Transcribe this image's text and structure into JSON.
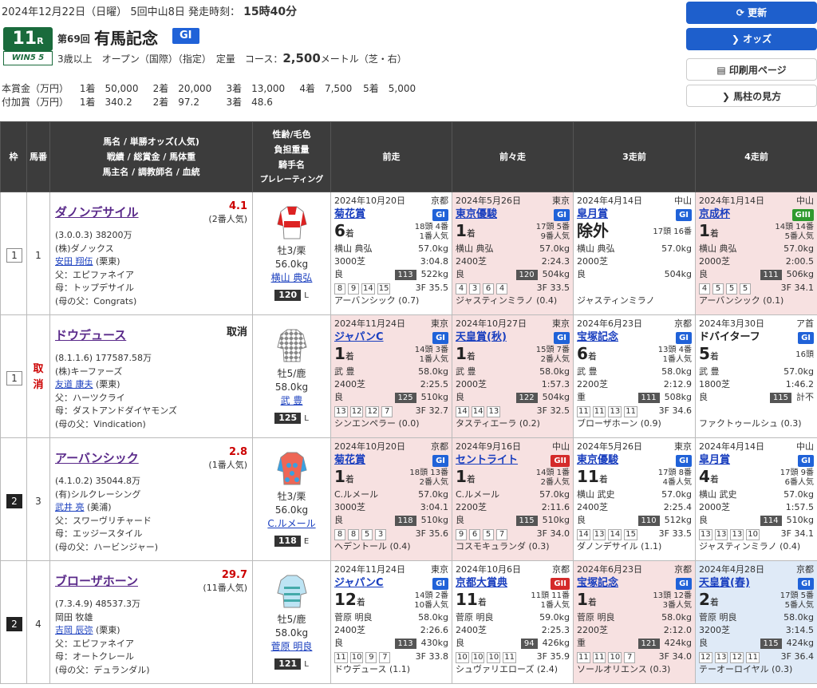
{
  "header": {
    "date": "2024年12月22日（日曜）",
    "meeting": "5回中山8日",
    "post_label": "発走時刻：",
    "post_time": "15時40分",
    "race_no": "11",
    "race_unit": "R",
    "win5_label": "WIN5 5",
    "race_count": "第69回",
    "race_name": "有馬記念",
    "grade": "GI",
    "conditions": "3歳以上　オープン（国際）（指定）　定量　コース：",
    "distance": "2,500",
    "course_suffix": "メートル（芝・右）",
    "prize_label": "本賞金（万円）",
    "prize_values": [
      "1着　50,000",
      "2着　20,000",
      "3着　13,000",
      "4着　7,500",
      "5着　5,000"
    ],
    "addprize_label": "付加賞（万円）",
    "addprize_values": [
      "1着　340.2",
      "2着　97.2",
      "3着　48.6"
    ]
  },
  "buttons": {
    "refresh": "⟳ 更新",
    "odds": "❯ オッズ",
    "print": "▤ 印刷用ページ",
    "howto": "❯ 馬柱の見方"
  },
  "columns": {
    "waku": "枠",
    "umaban": "馬番",
    "horse": [
      "馬名 / 単勝オッズ(人気)",
      "戦績 / 総賞金 / 馬体重",
      "馬主名 / 調教師名 / 血統"
    ],
    "jockey": [
      "性齢/毛色",
      "負担重量",
      "騎手名",
      "プレレーティング"
    ],
    "prev1": "前走",
    "prev2": "前々走",
    "prev3": "3走前",
    "prev4": "4走前"
  },
  "horses": [
    {
      "waku": "1",
      "umaban": "1",
      "scratch": "",
      "name": "ダノンデサイル",
      "odds": "4.1",
      "pop": "(2番人気)",
      "record": "(3.0.0.3)  38200万",
      "owner": "(株)ダノックス",
      "trainer": "安田 翔伍",
      "trainer_loc": "(栗東)",
      "sire": "父：エピファネイア",
      "dam": "母：トップデサイル",
      "damsire": "(母の父：Congrats)",
      "sex_age": "牡3/栗",
      "weight": "56.0kg",
      "jockey": "横山 典弘",
      "rating": "120",
      "rating_side": "L",
      "past": [
        {
          "date": "2024年10月20日",
          "venue": "京都",
          "race": "菊花賞",
          "grade": "GI",
          "pos": "6",
          "pos_suf": "着",
          "field": "18頭 4番",
          "pop": "1番人気",
          "jockey": "横山 典弘",
          "kg": "57.0kg",
          "course": "3000芝",
          "time": "3:04.8",
          "going": "良",
          "badge": "113",
          "bw": "522kg",
          "corners": [
            "8",
            "9",
            "14",
            "15"
          ],
          "f3": "3F 35.5",
          "winner": "アーバンシック (0.7)",
          "bg": "w"
        },
        {
          "date": "2024年5月26日",
          "venue": "東京",
          "race": "東京優駿",
          "grade": "GI",
          "pos": "1",
          "pos_suf": "着",
          "field": "17頭 5番",
          "pop": "9番人気",
          "jockey": "横山 典弘",
          "kg": "57.0kg",
          "course": "2400芝",
          "time": "2:24.3",
          "going": "良",
          "badge": "120",
          "bw": "504kg",
          "corners": [
            "4",
            "3",
            "6",
            "4"
          ],
          "f3": "3F 33.5",
          "winner": "ジャスティンミラノ (0.4)",
          "bg": "p"
        },
        {
          "date": "2024年4月14日",
          "venue": "中山",
          "race": "皐月賞",
          "grade": "GI",
          "pos": "除外",
          "pos_suf": "",
          "field": "17頭 16番",
          "pop": "",
          "jockey": "横山 典弘",
          "kg": "57.0kg",
          "course": "2000芝",
          "time": "",
          "going": "良",
          "badge": "",
          "bw": "504kg",
          "corners": [],
          "f3": "",
          "winner": "ジャスティンミラノ",
          "bg": "w"
        },
        {
          "date": "2024年1月14日",
          "venue": "中山",
          "race": "京成杯",
          "grade": "GIII",
          "pos": "1",
          "pos_suf": "着",
          "field": "14頭 14番",
          "pop": "5番人気",
          "jockey": "横山 典弘",
          "kg": "57.0kg",
          "course": "2000芝",
          "time": "2:00.5",
          "going": "良",
          "badge": "111",
          "bw": "506kg",
          "corners": [
            "4",
            "5",
            "5",
            "5"
          ],
          "f3": "3F 34.1",
          "winner": "アーバンシック (0.1)",
          "bg": "p"
        }
      ]
    },
    {
      "waku": "1",
      "umaban": "",
      "scratch": "取消",
      "name": "ドウデュース",
      "odds": "取消",
      "pop": "",
      "record": "(8.1.1.6)  177587.58万",
      "owner": "(株)キーファーズ",
      "trainer": "友道 康夫",
      "trainer_loc": "(栗東)",
      "sire": "父：ハーツクライ",
      "dam": "母：ダストアンドダイヤモンズ",
      "damsire": "(母の父：Vindication)",
      "sex_age": "牡5/鹿",
      "weight": "58.0kg",
      "jockey": "武 豊",
      "rating": "125",
      "rating_side": "L",
      "past": [
        {
          "date": "2024年11月24日",
          "venue": "東京",
          "race": "ジャパンC",
          "grade": "GI",
          "pos": "1",
          "pos_suf": "着",
          "field": "14頭 3番",
          "pop": "1番人気",
          "jockey": "武 豊",
          "kg": "58.0kg",
          "course": "2400芝",
          "time": "2:25.5",
          "going": "良",
          "badge": "125",
          "bw": "510kg",
          "corners": [
            "13",
            "12",
            "12",
            "7"
          ],
          "f3": "3F 32.7",
          "winner": "シンエンペラー (0.0)",
          "bg": "p"
        },
        {
          "date": "2024年10月27日",
          "venue": "東京",
          "race": "天皇賞(秋)",
          "grade": "GI",
          "pos": "1",
          "pos_suf": "着",
          "field": "15頭 7番",
          "pop": "2番人気",
          "jockey": "武 豊",
          "kg": "58.0kg",
          "course": "2000芝",
          "time": "1:57.3",
          "going": "良",
          "badge": "122",
          "bw": "504kg",
          "corners": [
            "14",
            "14",
            "13"
          ],
          "f3": "3F 32.5",
          "winner": "タスティエーラ (0.2)",
          "bg": "p"
        },
        {
          "date": "2024年6月23日",
          "venue": "京都",
          "race": "宝塚記念",
          "grade": "GI",
          "pos": "6",
          "pos_suf": "着",
          "field": "13頭 4番",
          "pop": "1番人気",
          "jockey": "武 豊",
          "kg": "58.0kg",
          "course": "2200芝",
          "time": "2:12.9",
          "going": "重",
          "badge": "111",
          "bw": "508kg",
          "corners": [
            "11",
            "11",
            "13",
            "11"
          ],
          "f3": "3F 34.6",
          "winner": "ブローザホーン (0.9)",
          "bg": "w"
        },
        {
          "date": "2024年3月30日",
          "venue": "ア首",
          "race": "ドバイターフ",
          "grade": "GI",
          "pos": "5",
          "pos_suf": "着",
          "field": "16頭",
          "pop": "",
          "jockey": "武 豊",
          "kg": "57.0kg",
          "course": "1800芝",
          "time": "1:46.2",
          "going": "良",
          "badge": "115",
          "bw": "計不",
          "corners": [],
          "f3": "",
          "winner": "ファクトゥールシュ (0.3)",
          "bg": "w"
        }
      ]
    },
    {
      "waku": "2",
      "umaban": "3",
      "scratch": "",
      "name": "アーバンシック",
      "odds": "2.8",
      "pop": "(1番人気)",
      "record": "(4.1.0.2)  35044.8万",
      "owner": "(有)シルクレーシング",
      "trainer": "武井 亮",
      "trainer_loc": "(美浦)",
      "sire": "父：スワーヴリチャード",
      "dam": "母：エッジースタイル",
      "damsire": "(母の父：ハービンジャー)",
      "sex_age": "牡3/栗",
      "weight": "56.0kg",
      "jockey": "C.ルメール",
      "rating": "118",
      "rating_side": "E",
      "past": [
        {
          "date": "2024年10月20日",
          "venue": "京都",
          "race": "菊花賞",
          "grade": "GI",
          "pos": "1",
          "pos_suf": "着",
          "field": "18頭 13番",
          "pop": "2番人気",
          "jockey": "C.ルメール",
          "kg": "57.0kg",
          "course": "3000芝",
          "time": "3:04.1",
          "going": "良",
          "badge": "118",
          "bw": "510kg",
          "corners": [
            "8",
            "8",
            "5",
            "3"
          ],
          "f3": "3F 35.6",
          "winner": "ヘデントール (0.4)",
          "bg": "p"
        },
        {
          "date": "2024年9月16日",
          "venue": "中山",
          "race": "セントライト",
          "grade": "GII",
          "pos": "1",
          "pos_suf": "着",
          "field": "14頭 1番",
          "pop": "2番人気",
          "jockey": "C.ルメール",
          "kg": "57.0kg",
          "course": "2200芝",
          "time": "2:11.6",
          "going": "良",
          "badge": "115",
          "bw": "510kg",
          "corners": [
            "9",
            "6",
            "5",
            "7"
          ],
          "f3": "3F 34.0",
          "winner": "コスモキュランダ (0.3)",
          "bg": "p"
        },
        {
          "date": "2024年5月26日",
          "venue": "東京",
          "race": "東京優駿",
          "grade": "GI",
          "pos": "11",
          "pos_suf": "着",
          "field": "17頭 8番",
          "pop": "4番人気",
          "jockey": "横山 武史",
          "kg": "57.0kg",
          "course": "2400芝",
          "time": "2:25.4",
          "going": "良",
          "badge": "110",
          "bw": "512kg",
          "corners": [
            "14",
            "13",
            "14",
            "15"
          ],
          "f3": "3F 33.5",
          "winner": "ダノンデサイル (1.1)",
          "bg": "w"
        },
        {
          "date": "2024年4月14日",
          "venue": "中山",
          "race": "皐月賞",
          "grade": "GI",
          "pos": "4",
          "pos_suf": "着",
          "field": "17頭 9番",
          "pop": "6番人気",
          "jockey": "横山 武史",
          "kg": "57.0kg",
          "course": "2000芝",
          "time": "1:57.5",
          "going": "良",
          "badge": "114",
          "bw": "510kg",
          "corners": [
            "13",
            "13",
            "13",
            "10"
          ],
          "f3": "3F 34.1",
          "winner": "ジャスティンミラノ (0.4)",
          "bg": "w"
        }
      ]
    },
    {
      "waku": "2",
      "umaban": "4",
      "scratch": "",
      "name": "ブローザホーン",
      "odds": "29.7",
      "pop": "(11番人気)",
      "record": "(7.3.4.9)  48537.3万",
      "owner": "岡田 牧雄",
      "trainer": "吉岡 辰弥",
      "trainer_loc": "(栗東)",
      "sire": "父：エピファネイア",
      "dam": "母：オートクレール",
      "damsire": "(母の父：デュランダル)",
      "sex_age": "牡5/鹿",
      "weight": "58.0kg",
      "jockey": "菅原 明良",
      "rating": "121",
      "rating_side": "L",
      "past": [
        {
          "date": "2024年11月24日",
          "venue": "東京",
          "race": "ジャパンC",
          "grade": "GI",
          "pos": "12",
          "pos_suf": "着",
          "field": "14頭 2番",
          "pop": "10番人気",
          "jockey": "菅原 明良",
          "kg": "58.0kg",
          "course": "2400芝",
          "time": "2:26.6",
          "going": "良",
          "badge": "113",
          "bw": "430kg",
          "corners": [
            "11",
            "10",
            "9",
            "7"
          ],
          "f3": "3F 33.8",
          "winner": "ドウデュース (1.1)",
          "bg": "w"
        },
        {
          "date": "2024年10月6日",
          "venue": "京都",
          "race": "京都大賞典",
          "grade": "GII",
          "pos": "11",
          "pos_suf": "着",
          "field": "11頭 11番",
          "pop": "1番人気",
          "jockey": "菅原 明良",
          "kg": "59.0kg",
          "course": "2400芝",
          "time": "2:25.3",
          "going": "良",
          "badge": "94",
          "bw": "426kg",
          "corners": [
            "10",
            "10",
            "10",
            "11"
          ],
          "f3": "3F 35.9",
          "winner": "シュヴァリエローズ (2.4)",
          "bg": "w"
        },
        {
          "date": "2024年6月23日",
          "venue": "京都",
          "race": "宝塚記念",
          "grade": "GI",
          "pos": "1",
          "pos_suf": "着",
          "field": "13頭 12番",
          "pop": "3番人気",
          "jockey": "菅原 明良",
          "kg": "58.0kg",
          "course": "2200芝",
          "time": "2:12.0",
          "going": "重",
          "badge": "121",
          "bw": "424kg",
          "corners": [
            "11",
            "11",
            "10",
            "7"
          ],
          "f3": "3F 34.0",
          "winner": "ソールオリエンス (0.3)",
          "bg": "p"
        },
        {
          "date": "2024年4月28日",
          "venue": "京都",
          "race": "天皇賞(春)",
          "grade": "GI",
          "pos": "2",
          "pos_suf": "着",
          "field": "17頭 5番",
          "pop": "5番人気",
          "jockey": "菅原 明良",
          "kg": "58.0kg",
          "course": "3200芝",
          "time": "3:14.5",
          "going": "良",
          "badge": "115",
          "bw": "424kg",
          "corners": [
            "12",
            "13",
            "12",
            "11"
          ],
          "f3": "3F 36.4",
          "winner": "テーオーロイヤル (0.3)",
          "bg": "b"
        }
      ]
    }
  ],
  "colors": {
    "header_bg": "#3c3c3c",
    "grade_blue": "#2062d8",
    "grade_red": "#d42a2a",
    "grade_green": "#2e9a2e",
    "pink": "#f7e1e1",
    "light_blue": "#dfeaf7",
    "link": "#1a3fbf",
    "name": "#5a2a8a",
    "race_badge": "#1a6b3c"
  }
}
